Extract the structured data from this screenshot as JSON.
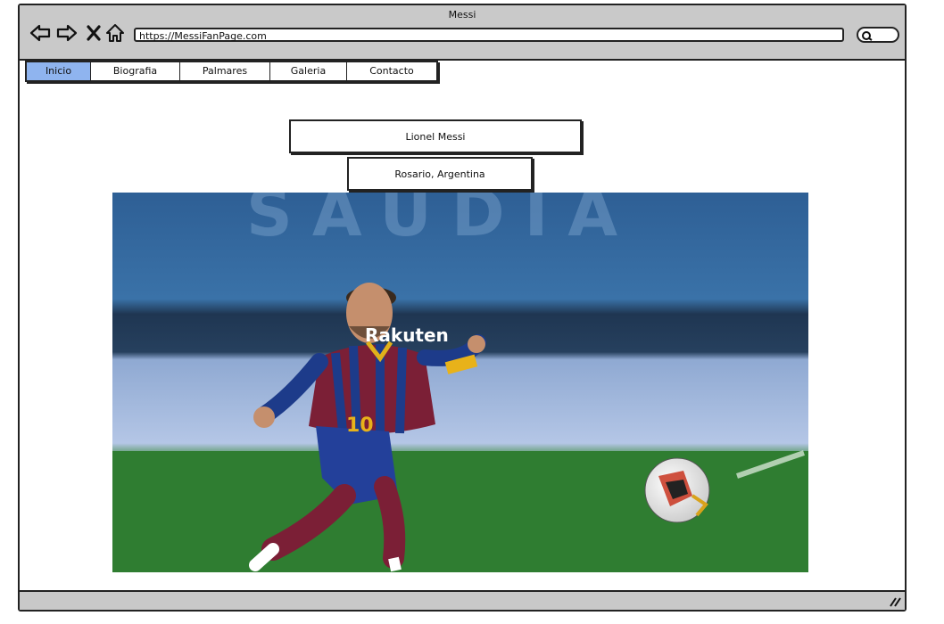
{
  "window": {
    "title": "Messi"
  },
  "browser": {
    "url": "https://MessiFanPage.com",
    "icons": [
      "back-arrow-icon",
      "forward-arrow-icon",
      "close-x-icon",
      "home-icon",
      "search-icon"
    ]
  },
  "nav": {
    "tabs": [
      {
        "label": "Inicio",
        "active": true
      },
      {
        "label": "Biografia",
        "active": false
      },
      {
        "label": "Palmares",
        "active": false
      },
      {
        "label": "Galeria",
        "active": false
      },
      {
        "label": "Contacto",
        "active": false
      }
    ]
  },
  "main": {
    "name": "Lionel Messi",
    "birthplace": "Rosario, Argentina",
    "photo": {
      "jersey_sponsor": "Rakuten",
      "jersey_number": "10"
    }
  },
  "colors": {
    "active_tab": "#8fb4ef",
    "chrome": "#c9c9c9"
  }
}
